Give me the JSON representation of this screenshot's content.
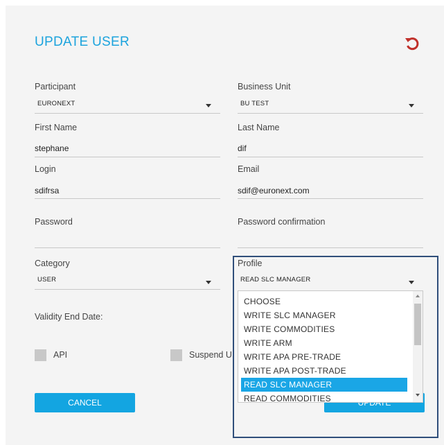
{
  "form": {
    "title": "UPDATE USER",
    "participant": {
      "label": "Participant",
      "value": "EURONEXT"
    },
    "business_unit": {
      "label": "Business Unit",
      "value": "BU TEST"
    },
    "first_name": {
      "label": "First Name",
      "value": "stephane"
    },
    "last_name": {
      "label": "Last Name",
      "value": "dif"
    },
    "login": {
      "label": "Login",
      "value": "sdifrsa"
    },
    "email": {
      "label": "Email",
      "value": "sdif@euronext.com"
    },
    "password": {
      "label": "Password",
      "value": ""
    },
    "password_confirmation": {
      "label": "Password confirmation",
      "value": ""
    },
    "category": {
      "label": "Category",
      "value": "USER"
    },
    "profile": {
      "label": "Profile",
      "value": "READ SLC MANAGER",
      "options": [
        "CHOOSE",
        "WRITE SLC MANAGER",
        "WRITE COMMODITIES",
        "WRITE ARM",
        "WRITE APA PRE-TRADE",
        "WRITE APA POST-TRADE",
        "READ SLC MANAGER",
        "READ COMMODITIES"
      ],
      "selected_option": "READ SLC MANAGER"
    },
    "validity_end_date": {
      "label": "Validity End Date:"
    },
    "api_checkbox": {
      "label": "API",
      "checked": false
    },
    "suspend_checkbox": {
      "label": "Suspend U",
      "checked": false
    },
    "cancel_label": "CANCEL",
    "update_label": "UPDATE"
  },
  "colors": {
    "accent": "#1ba3dd",
    "button": "#13a5e1",
    "reset_icon": "#c0302a",
    "highlight_border": "#2f4e7a"
  },
  "icons": {
    "reset": "undo-arrow-icon",
    "dropdown": "caret-down-icon"
  }
}
